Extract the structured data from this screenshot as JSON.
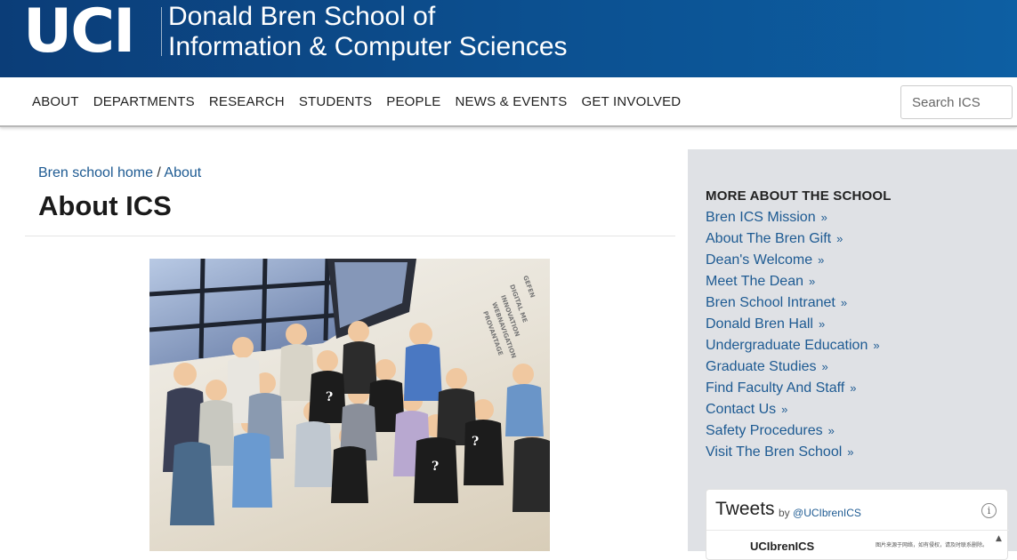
{
  "header": {
    "logo_text": "UCI",
    "school_line1": "Donald Bren School of",
    "school_line2": "Information & Computer Sciences",
    "brand_color": "#0c4f8f"
  },
  "nav": {
    "items": [
      "ABOUT",
      "DEPARTMENTS",
      "RESEARCH",
      "STUDENTS",
      "PEOPLE",
      "NEWS & EVENTS",
      "GET INVOLVED"
    ],
    "search_placeholder": "Search ICS"
  },
  "breadcrumb": {
    "home": "Bren school home",
    "separator": " / ",
    "current": "About"
  },
  "page_title": "About ICS",
  "photo": {
    "icon": "group-photo-image",
    "wall_text": [
      "GEFEN",
      "DIGITAL ME",
      "INNOVATION",
      "WEBNAVIGATION",
      "PROVANTAGE"
    ]
  },
  "sidebar": {
    "heading": "MORE ABOUT THE SCHOOL",
    "links": [
      "Bren ICS Mission",
      "About The Bren Gift",
      "Dean's Welcome",
      "Meet The Dean",
      "Bren School Intranet",
      "Donald Bren Hall",
      "Undergraduate Education",
      "Graduate Studies",
      "Find Faculty And Staff",
      "Contact Us",
      "Safety Procedures",
      "Visit The Bren School"
    ],
    "link_icon": "double-chevron-right-icon"
  },
  "tweets": {
    "title": "Tweets",
    "by_label": "by",
    "handle": "@UCIbrenICS",
    "user": "UCIbrenICS",
    "watermark": "图片来源于网络，如有侵权，请及时联系删除。"
  }
}
